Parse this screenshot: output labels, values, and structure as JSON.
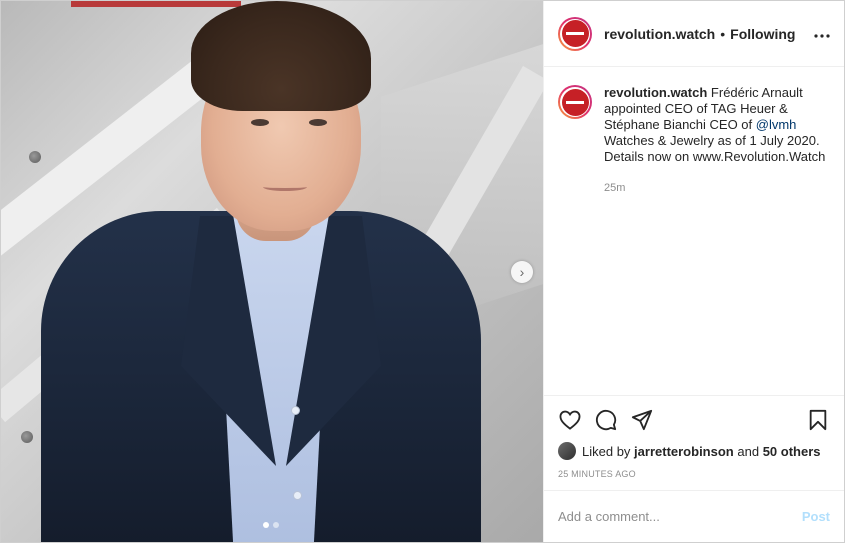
{
  "header": {
    "username": "revolution.watch",
    "separator": "•",
    "follow_status": "Following",
    "more_icon": "more-horizontal-icon"
  },
  "caption": {
    "username": "revolution.watch",
    "text_before": "Frédéric Arnault appointed CEO of TAG Heuer & Stéphane Bianchi CEO of ",
    "mention": "@lvmh",
    "text_after": " Watches & Jewelry as of 1 July 2020. Details now on www.Revolution.Watch",
    "time": "25m"
  },
  "actions": {
    "icons": [
      "heart-icon",
      "comment-icon",
      "share-icon",
      "bookmark-icon"
    ]
  },
  "likes": {
    "prefix": "Liked by",
    "user": "jarretterobinson",
    "conjunction": "and",
    "others": "50 others"
  },
  "post_time": "25 MINUTES AGO",
  "comment": {
    "placeholder": "Add a comment...",
    "post_label": "Post"
  },
  "media": {
    "slides": 2,
    "active_slide": 1,
    "next_glyph": "›"
  },
  "colors": {
    "brand_red": "#c62026",
    "mention_blue": "#00376b",
    "post_disabled": "#b2dffc",
    "muted": "#8e8e8e"
  }
}
